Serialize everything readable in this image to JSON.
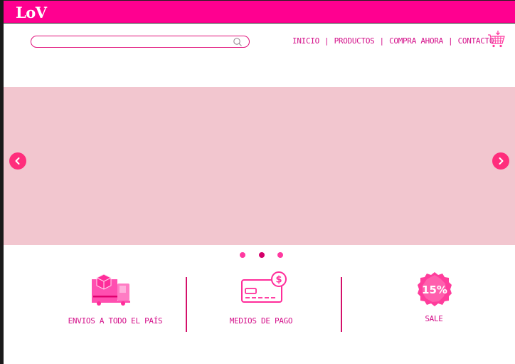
{
  "header": {
    "logo_text": "LoV",
    "brand_color": "#ff0090"
  },
  "search": {
    "placeholder": "",
    "value": "",
    "icon": "search-icon"
  },
  "nav": {
    "items": [
      {
        "label": "INICIO"
      },
      {
        "label": "PRODUCTOS"
      },
      {
        "label": "COMPRA AHORA"
      },
      {
        "label": "CONTACTO"
      }
    ],
    "separator": "|",
    "cart_icon": "shopping-cart-icon"
  },
  "carousel": {
    "background": "#f2c6cf",
    "prev_icon": "chevron-left-icon",
    "next_icon": "chevron-right-icon",
    "slide_count": 3,
    "active_index": 1
  },
  "features": [
    {
      "label": "ENVIOS A TODO EL PAÍS",
      "icon": "delivery-truck-icon"
    },
    {
      "label": "MEDIOS DE PAGO",
      "icon": "credit-card-icon"
    },
    {
      "label": "SALE",
      "icon": "sale-badge-icon",
      "badge_text": "15%"
    }
  ]
}
